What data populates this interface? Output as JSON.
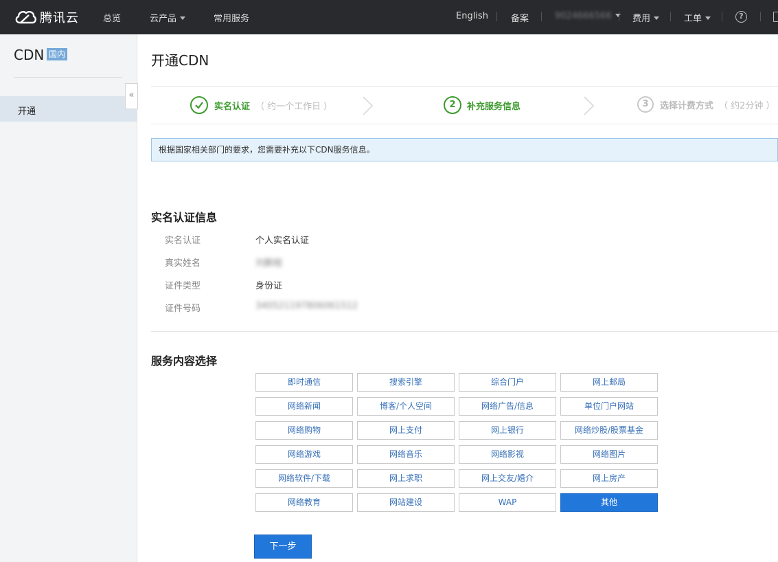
{
  "topbar": {
    "logo_text": "腾讯云",
    "nav": [
      {
        "label": "总览"
      },
      {
        "label": "云产品"
      },
      {
        "label": "常用服务"
      }
    ],
    "english": "English",
    "filing": "备案",
    "account": "9024666566",
    "billing": "费用",
    "ticket": "工单",
    "help_icon": "question-circle-icon"
  },
  "sidebar": {
    "title": "CDN",
    "badge": "国内",
    "items": [
      {
        "label": "开通"
      }
    ],
    "collapse_icon": "«"
  },
  "main": {
    "title": "开通CDN",
    "steps": [
      {
        "num": "1",
        "label": "实名认证",
        "note": "（ 约一个工作日 ）",
        "state": "done"
      },
      {
        "num": "2",
        "label": "补充服务信息",
        "note": "",
        "state": "active"
      },
      {
        "num": "3",
        "label": "选择计费方式",
        "note": "（ 约2分钟 ）",
        "state": "pending"
      }
    ],
    "notice": "根据国家相关部门的要求，您需要补充以下CDN服务信息。",
    "realname": {
      "title": "实名认证信息",
      "rows": [
        {
          "label": "实名认证",
          "value": "个人实名认证"
        },
        {
          "label": "真实姓名",
          "value": "刘鹏程"
        },
        {
          "label": "证件类型",
          "value": "身份证"
        },
        {
          "label": "证件号码",
          "value": "340521197806061512"
        }
      ]
    },
    "services": {
      "title": "服务内容选择",
      "options": [
        "即时通信",
        "搜索引擎",
        "综合门户",
        "网上邮局",
        "网络新闻",
        "博客/个人空间",
        "网络广告/信息",
        "单位门户网站",
        "网络购物",
        "网上支付",
        "网上银行",
        "网络炒股/股票基金",
        "网络游戏",
        "网络音乐",
        "网络影视",
        "网络图片",
        "网络软件/下载",
        "网上求职",
        "网上交友/婚介",
        "网上房产",
        "网络教育",
        "网站建设",
        "WAP",
        "其他"
      ],
      "selected": "其他"
    },
    "next_button": "下一步"
  },
  "colors": {
    "topbar_bg": "#292a2d",
    "step_green": "#3d9b2e",
    "primary_blue": "#2277da",
    "link_blue": "#3770b8",
    "notice_bg": "#e6f2fb"
  }
}
